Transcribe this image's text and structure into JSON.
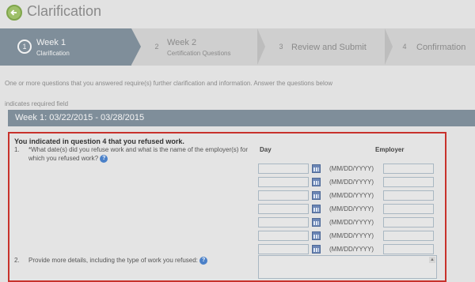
{
  "page": {
    "title": "Clarification"
  },
  "steps": [
    {
      "num": "1",
      "label": "Week 1",
      "sub": "Clarification"
    },
    {
      "num": "2",
      "label": "Week 2",
      "sub": "Certification Questions"
    },
    {
      "num": "3",
      "label": "Review and Submit",
      "sub": ""
    },
    {
      "num": "4",
      "label": "Confirmation",
      "sub": ""
    }
  ],
  "intro": "One or more questions that you answered require(s) further clarification and information. Answer the questions below",
  "required_note": "indicates required field",
  "week": {
    "label": "Week 1: 03/22/2015 -  03/28/2015"
  },
  "panel": {
    "heading": "You indicated in question 4 that you refused work.",
    "q1": {
      "num": "1.",
      "text": "*What date(s) did you refuse work and what is the name of the employer(s) for which you refused work?"
    },
    "col_day": "Day",
    "col_employer": "Employer",
    "date_format": "(MM/DD/YYYY)",
    "q2": {
      "num": "2.",
      "text": "Provide more details, including the type of work you refused:"
    }
  },
  "colors": {
    "accent": "#7f8e9a",
    "highlight_border": "#c8322c",
    "help_icon": "#4a80c8"
  }
}
